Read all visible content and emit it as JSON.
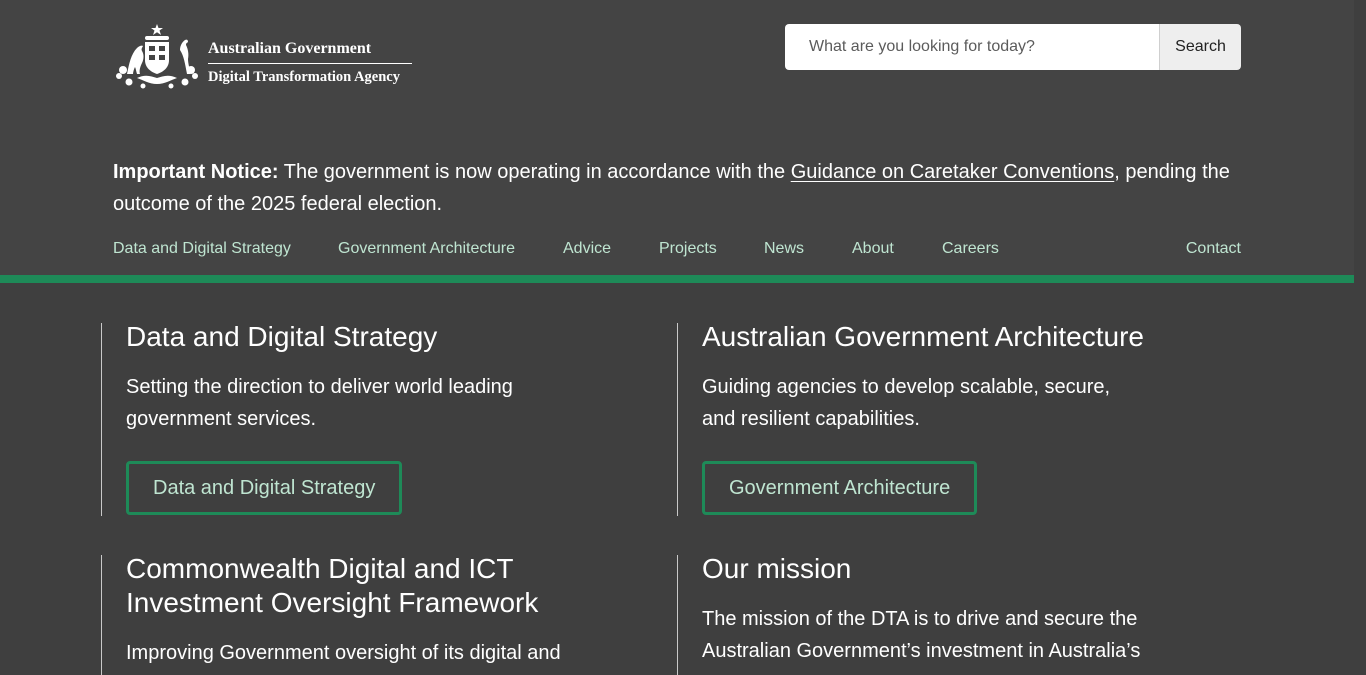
{
  "header": {
    "logo": {
      "line1": "Australian Government",
      "line2": "Digital Transformation Agency"
    },
    "search": {
      "placeholder": "What are you looking for today?",
      "button_label": "Search"
    }
  },
  "notice": {
    "label": "Important Notice:",
    "text_before": " The government is now operating in accordance with the ",
    "link_text": "Guidance on Caretaker Conventions",
    "text_after": ", pending the outcome of the 2025 federal election."
  },
  "nav": {
    "items": [
      {
        "label": "Data and Digital Strategy"
      },
      {
        "label": "Government Architecture"
      },
      {
        "label": "Advice"
      },
      {
        "label": "Projects"
      },
      {
        "label": "News"
      },
      {
        "label": "About"
      },
      {
        "label": "Careers"
      }
    ],
    "contact_label": "Contact"
  },
  "cards": [
    {
      "title": "Data and Digital Strategy",
      "description": "Setting the direction to deliver world leading government services.",
      "button_label": "Data and Digital Strategy"
    },
    {
      "title": "Australian Government Architecture",
      "description": "Guiding agencies to develop scalable, secure, and resilient capabilities.",
      "button_label": "Government Architecture"
    },
    {
      "title": "Commonwealth Digital and ICT Investment Oversight Framework",
      "description": "Improving Government oversight of its digital and"
    },
    {
      "title": "Our mission",
      "description": "The mission of the DTA is to drive and secure the Australian Government’s investment in Australia’s"
    }
  ],
  "colors": {
    "background": "#3f3f3f",
    "header_background": "#444444",
    "accent_green": "#1e8a58",
    "nav_link": "#bfe5d1"
  }
}
